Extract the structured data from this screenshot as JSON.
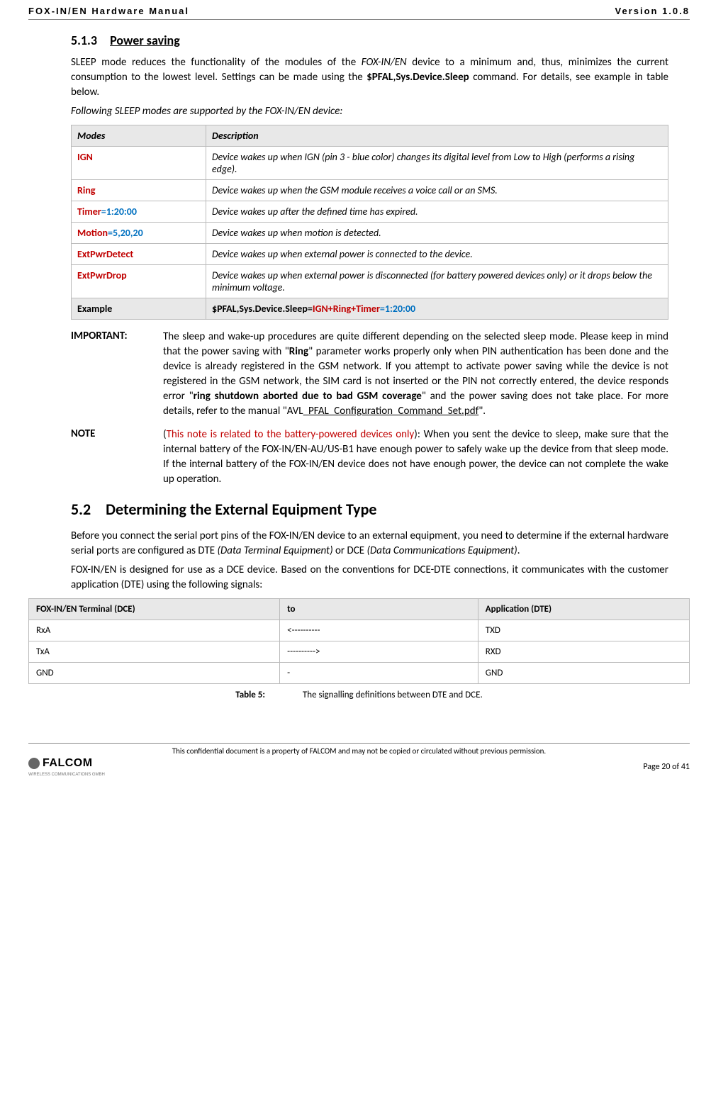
{
  "header": {
    "left": "FOX-IN/EN Hardware Manual",
    "right": "Version 1.0.8"
  },
  "section513": {
    "num": "5.1.3",
    "title": "Power saving",
    "p1_a": "SLEEP mode reduces the functionality of the modules of the ",
    "p1_b": "FOX-IN/EN",
    "p1_c": " device  to  a minimum and, thus, minimizes the current consumption to the lowest level. Settings can be made using the ",
    "p1_d": "$PFAL,Sys.Device.Sleep",
    "p1_e": " command. For details, see example in table below.",
    "p2": "Following SLEEP modes are supported by the FOX-IN/EN device:"
  },
  "modesTable": {
    "h1": "Modes",
    "h2": "Description",
    "rows": [
      {
        "mode": "IGN",
        "modeClass": "red",
        "desc_a": "Device wakes up when IGN (pin 3 - blue color) changes its digital level from Low to High (performs a rising edge).",
        "desc_b": "",
        "desc_c": ""
      },
      {
        "mode": "Ring",
        "modeClass": "red",
        "desc_a": "Device wakes up when the GSM module receives a voice call or an SMS.",
        "desc_b": "",
        "desc_c": ""
      },
      {
        "mode_a": "Timer",
        "mode_b": "=",
        "mode_c": "1:20:00",
        "desc_a": "Device wakes up after the defined time has expired.",
        "desc_b": "",
        "desc_c": ""
      },
      {
        "mode_a": "Motion",
        "mode_b": "=",
        "mode_c": "5,20,20",
        "desc_a": "Device wakes up when motion is detected.",
        "desc_b": "",
        "desc_c": ""
      },
      {
        "mode": "ExtPwrDetect",
        "modeClass": "red",
        "desc_a": "Device wakes up when external power is connected to the device.",
        "desc_b": "",
        "desc_c": ""
      },
      {
        "mode": "ExtPwrDrop",
        "modeClass": "red",
        "desc_a": "Device wakes up when external power is disconnected (for battery powered devices only) or it drops below the minimum voltage.",
        "desc_b": "",
        "desc_c": ""
      }
    ],
    "example": {
      "label": "Example",
      "prefix": "$PFAL,Sys.Device.Sleep=",
      "red": "IGN+Ring+Timer",
      "eq": "=",
      "blue": "1:20:00"
    }
  },
  "important": {
    "label": "IMPORTANT:",
    "a": "The sleep and wake-up procedures are quite different depending on the selected sleep mode. Please  keep in mind that the power saving with \"",
    "b": "Ring",
    "c": "\" parameter works properly only when PIN authentication has been done and the device is already registered in the GSM network. If you attempt to activate power saving while the device is not registered in the GSM network, the SIM card is not inserted or the PIN not correctly entered, the device responds error \"",
    "d": "ring shutdown aborted due to bad GSM coverage",
    "e": "\" and the power saving does not take place. For more details, refer to the manual \"AVL",
    "f": "_PFAL_Configuration_Command_Set.pdf",
    "g": "\"."
  },
  "note": {
    "label": "NOTE",
    "a": "(",
    "b": "This note is related to the battery-powered devices only",
    "c": "): When you sent the device to sleep, make sure that the internal battery of the FOX-IN/EN-AU/US-B1 have enough power to safely wake up the device from that sleep mode. If the internal battery of the FOX-IN/EN device does not have enough power, the device can not complete the wake up operation."
  },
  "section52": {
    "num": "5.2",
    "title": "Determining the External Equipment Type",
    "p1_a": "Before you connect the serial port pins of the FOX-IN/EN device to an external equipment, you need to determine if the external hardware serial ports are configured as DTE ",
    "p1_b": "(Data Terminal Equipment)",
    "p1_c": " or DCE ",
    "p1_d": "(Data Communications Equipment)",
    "p1_e": ".",
    "p2": "FOX-IN/EN is designed for use as a DCE device. Based on the conventions for DCE-DTE connections, it communicates with the customer application (DTE) using the following signals:"
  },
  "signalsTable": {
    "h1": "FOX-IN/EN Terminal (DCE)",
    "h2": "to",
    "h3": "Application (DTE)",
    "rows": [
      {
        "c1": "RxA",
        "c2": "<----------",
        "c3": "TXD"
      },
      {
        "c1": "TxA",
        "c2": "---------->",
        "c3": "RXD"
      },
      {
        "c1": "GND",
        "c2": "-",
        "c3": "GND"
      }
    ]
  },
  "caption": {
    "label": "Table 5:",
    "text": "The signalling definitions between DTE and DCE."
  },
  "footer": {
    "confidential": "This confidential document is a property of FALCOM and may not be copied or circulated without previous permission.",
    "pagenum": "Page 20 of 41",
    "logo_main": "FALCOM",
    "logo_sub": "WIRELESS COMMUNICATIONS GMBH"
  }
}
